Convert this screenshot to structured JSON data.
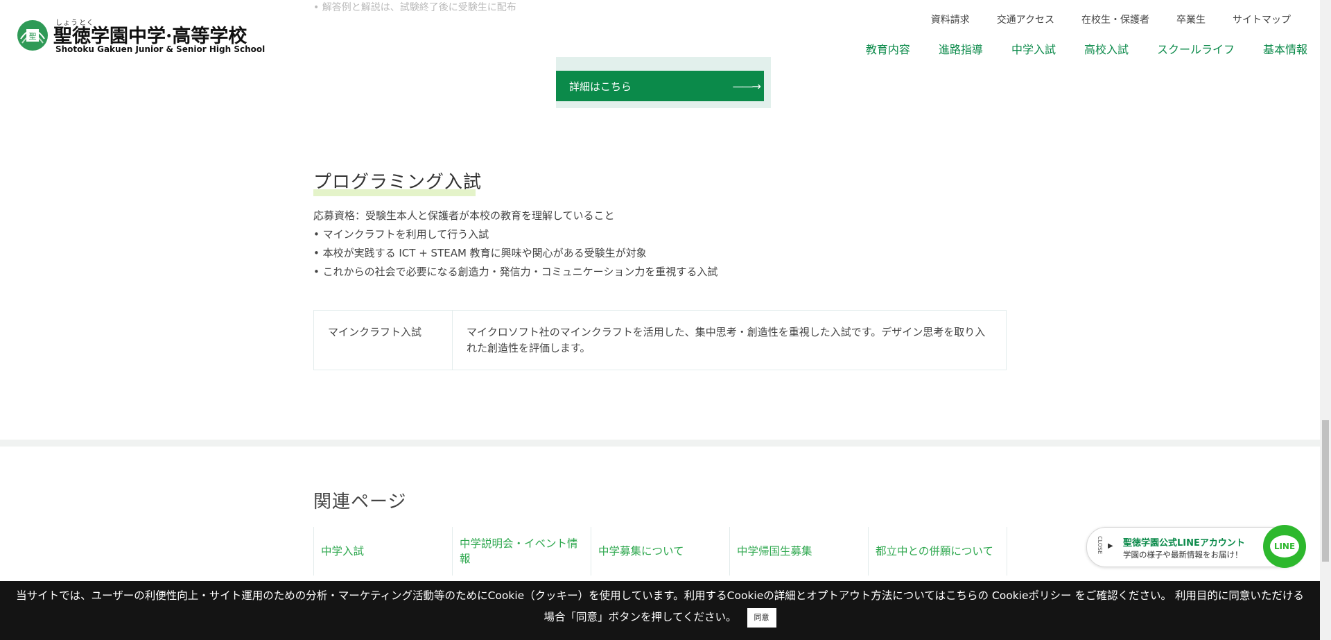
{
  "header": {
    "logo": {
      "ruby": [
        "しょう",
        "とく"
      ],
      "title": "聖徳学園中学·高等学校",
      "subtitle": "Shotoku Gakuen Junior & Senior High School"
    },
    "utility_nav": [
      "資料請求",
      "交通アクセス",
      "在校生・保護者",
      "卒業生",
      "サイトマップ"
    ],
    "main_nav": [
      "教育内容",
      "進路指導",
      "中学入試",
      "高校入試",
      "スクールライフ",
      "基本情報"
    ]
  },
  "top": {
    "faded_text": "• 解答例と解説は、試験終了後に受験生に配布",
    "cta_label": "詳細はこちら",
    "cta_arrow": "——→"
  },
  "programming": {
    "title": "プログラミング入試",
    "lines": [
      "応募資格：受験生本人と保護者が本校の教育を理解していること",
      "• マインクラフトを利用して行う入試",
      "• 本校が実践する ICT + STEAM 教育に興味や関心がある受験生が対象",
      "• これからの社会で必要になる創造力・発信力・コミュニケーション力を重視する入試"
    ],
    "table": {
      "head": "マインクラフト入試",
      "body": "マイクロソフト社のマインクラフトを活用した、集中思考・創造性を重視した入試です。デザイン思考を取り入れた創造性を評価します。"
    }
  },
  "related": {
    "title": "関連ページ",
    "items": [
      "中学入試",
      "中学説明会・イベント情報",
      "中学募集について",
      "中学帰国生募集",
      "都立中との併願について"
    ]
  },
  "line_banner": {
    "close": "CLOSE",
    "title": "聖徳学園公式LINEアカウント",
    "subtitle": "学園の様子や最新情報をお届け！",
    "badge": "LINE"
  },
  "cookie": {
    "text": "当サイトでは、ユーザーの利便性向上・サイト運用のための分析・マーケティング活動等のためにCookie（クッキー）を使用しています。利用するCookieの詳細とオプトアウト方法についてはこちらの Cookieポリシー をご確認ください。 利用目的に同意いただける場合「同意」ボタンを押してください。",
    "button": "同意"
  },
  "colors": {
    "brand_green": "#0b8a4a",
    "link_green": "#2fa84f",
    "line_green": "#2db82d",
    "highlight": "#e4f3c9"
  }
}
